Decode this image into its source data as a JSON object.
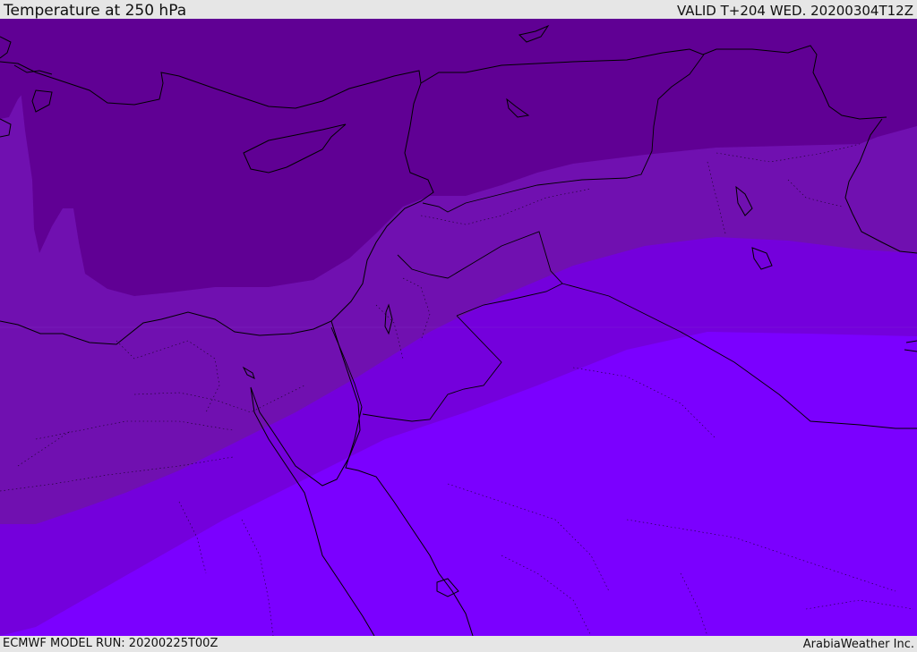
{
  "header": {
    "title": "Temperature at 250 hPa",
    "valid": "VALID T+204 WED. 20200304T12Z"
  },
  "footer": {
    "model_run": "ECMWF MODEL RUN: 20200225T00Z",
    "credit": "ArabiaWeather Inc."
  },
  "map": {
    "colors": {
      "band_coldest": "#600094",
      "band_cold": "#7010b0",
      "band_mid": "#7400dc",
      "band_warm": "#7b00ff",
      "coastline": "#000000",
      "header_bg": "#e6e6e6"
    }
  }
}
